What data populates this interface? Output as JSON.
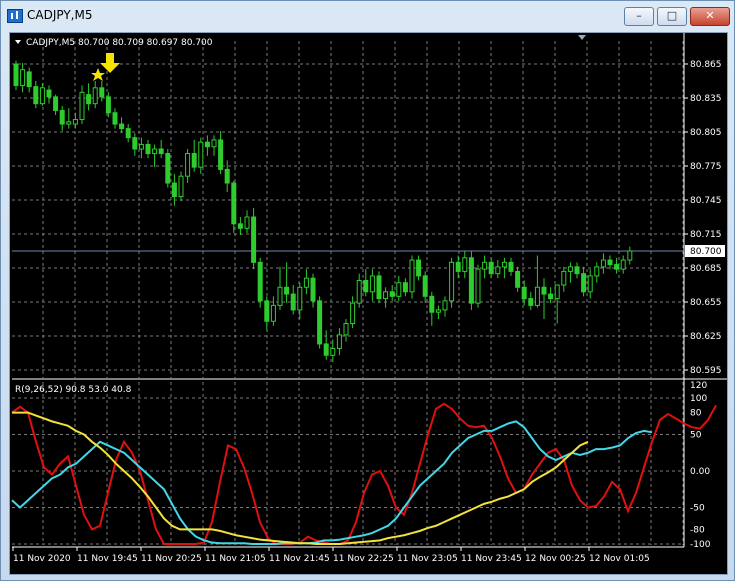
{
  "window": {
    "title": "CADJPY,M5",
    "buttons": {
      "min": "–",
      "max": "□",
      "close": "✕"
    }
  },
  "chart": {
    "header": "CADJPY,M5  80.700 80.709 80.697 80.700",
    "price_ticks": [
      "80.865",
      "80.835",
      "80.805",
      "80.775",
      "80.745",
      "80.715",
      "80.685",
      "80.655",
      "80.625",
      "80.595"
    ],
    "current_price": "80.700",
    "indicator_label": "R(9,26,52) 90.8 53.0 40.8",
    "indicator_ticks": [
      "120",
      "100",
      "80",
      "50",
      "0.00",
      "-50",
      "-80",
      "-100"
    ],
    "time_ticks": [
      "11 Nov 2020",
      "11 Nov 19:45",
      "11 Nov 20:25",
      "11 Nov 21:05",
      "11 Nov 21:45",
      "11 Nov 22:25",
      "11 Nov 23:05",
      "11 Nov 23:45",
      "12 Nov 00:25",
      "12 Nov 01:05"
    ],
    "colors": {
      "background": "#000000",
      "grid": "#7a7a7a",
      "bull": "#ffffff",
      "bear": "#2ecc2e",
      "line_red": "#e01010",
      "line_cyan": "#40d8e8",
      "line_yellow": "#f2e23a",
      "text": "#ffffff",
      "price_line": "#6f87a8",
      "arrow": "#f5e400"
    }
  },
  "chart_data": [
    {
      "type": "candlestick",
      "title": "CADJPY,M5",
      "ylim": [
        80.595,
        80.87
      ],
      "candles": [
        [
          80.865,
          80.868,
          80.842,
          80.846
        ],
        [
          80.846,
          80.866,
          80.84,
          80.86
        ],
        [
          80.858,
          80.862,
          80.84,
          80.845
        ],
        [
          80.845,
          80.85,
          80.826,
          80.83
        ],
        [
          80.83,
          80.848,
          80.828,
          80.844
        ],
        [
          80.842,
          80.846,
          80.83,
          80.836
        ],
        [
          80.836,
          80.838,
          80.82,
          80.824
        ],
        [
          80.824,
          80.828,
          80.806,
          80.812
        ],
        [
          80.812,
          80.826,
          80.808,
          80.814
        ],
        [
          80.812,
          80.822,
          80.808,
          80.816
        ],
        [
          80.816,
          80.846,
          80.812,
          80.84
        ],
        [
          80.838,
          80.848,
          80.824,
          80.83
        ],
        [
          80.83,
          80.85,
          80.826,
          80.844
        ],
        [
          80.844,
          80.85,
          80.832,
          80.836
        ],
        [
          80.836,
          80.84,
          80.818,
          80.822
        ],
        [
          80.822,
          80.826,
          80.808,
          80.812
        ],
        [
          80.812,
          80.818,
          80.804,
          80.808
        ],
        [
          80.808,
          80.812,
          80.796,
          80.8
        ],
        [
          80.8,
          80.804,
          80.784,
          80.79
        ],
        [
          80.79,
          80.8,
          80.782,
          80.794
        ],
        [
          80.794,
          80.798,
          80.782,
          80.786
        ],
        [
          80.786,
          80.794,
          80.774,
          80.79
        ],
        [
          80.79,
          80.798,
          80.782,
          80.786
        ],
        [
          80.786,
          80.79,
          80.756,
          80.76
        ],
        [
          80.76,
          80.768,
          80.74,
          80.748
        ],
        [
          80.748,
          80.77,
          80.744,
          80.766
        ],
        [
          80.766,
          80.79,
          80.76,
          80.786
        ],
        [
          80.786,
          80.798,
          80.77,
          80.774
        ],
        [
          80.774,
          80.8,
          80.768,
          80.796
        ],
        [
          80.796,
          80.802,
          80.784,
          80.792
        ],
        [
          80.792,
          80.802,
          80.784,
          80.798
        ],
        [
          80.798,
          80.806,
          80.768,
          80.772
        ],
        [
          80.772,
          80.78,
          80.752,
          80.76
        ],
        [
          80.76,
          80.762,
          80.716,
          80.724
        ],
        [
          80.724,
          80.73,
          80.714,
          80.72
        ],
        [
          80.72,
          80.736,
          80.716,
          80.73
        ],
        [
          80.73,
          80.738,
          80.684,
          80.69
        ],
        [
          80.69,
          80.694,
          80.65,
          80.656
        ],
        [
          80.656,
          80.66,
          80.63,
          80.638
        ],
        [
          80.638,
          80.66,
          80.634,
          80.652
        ],
        [
          80.652,
          80.686,
          80.648,
          80.668
        ],
        [
          80.668,
          80.69,
          80.654,
          80.662
        ],
        [
          80.662,
          80.67,
          80.644,
          80.648
        ],
        [
          80.648,
          80.672,
          80.64,
          80.668
        ],
        [
          80.668,
          80.684,
          80.662,
          80.676
        ],
        [
          80.676,
          80.68,
          80.65,
          80.656
        ],
        [
          80.656,
          80.66,
          80.614,
          80.618
        ],
        [
          80.618,
          80.63,
          80.604,
          80.608
        ],
        [
          80.608,
          80.622,
          80.602,
          80.614
        ],
        [
          80.614,
          80.632,
          80.608,
          80.626
        ],
        [
          80.626,
          80.64,
          80.62,
          80.636
        ],
        [
          80.636,
          80.66,
          80.632,
          80.654
        ],
        [
          80.654,
          80.68,
          80.65,
          80.674
        ],
        [
          80.674,
          80.684,
          80.66,
          80.664
        ],
        [
          80.664,
          80.684,
          80.656,
          80.678
        ],
        [
          80.678,
          80.682,
          80.654,
          80.658
        ],
        [
          80.658,
          80.668,
          80.65,
          80.664
        ],
        [
          80.664,
          80.67,
          80.656,
          80.66
        ],
        [
          80.66,
          80.678,
          80.656,
          80.672
        ],
        [
          80.672,
          80.676,
          80.66,
          80.664
        ],
        [
          80.664,
          80.696,
          80.658,
          80.692
        ],
        [
          80.692,
          80.696,
          80.674,
          80.678
        ],
        [
          80.678,
          80.682,
          80.654,
          80.66
        ],
        [
          80.66,
          80.664,
          80.634,
          80.646
        ],
        [
          80.646,
          80.652,
          80.64,
          80.648
        ],
        [
          80.648,
          80.66,
          80.642,
          80.656
        ],
        [
          80.656,
          80.694,
          80.65,
          80.69
        ],
        [
          80.69,
          80.696,
          80.676,
          80.682
        ],
        [
          80.682,
          80.7,
          80.676,
          80.694
        ],
        [
          80.694,
          80.7,
          80.648,
          80.654
        ],
        [
          80.654,
          80.688,
          80.65,
          80.684
        ],
        [
          80.684,
          80.696,
          80.676,
          80.69
        ],
        [
          80.69,
          80.694,
          80.676,
          80.68
        ],
        [
          80.68,
          80.692,
          80.676,
          80.686
        ],
        [
          80.686,
          80.694,
          80.676,
          80.69
        ],
        [
          80.69,
          80.694,
          80.678,
          80.682
        ],
        [
          80.682,
          80.686,
          80.664,
          80.668
        ],
        [
          80.668,
          80.674,
          80.652,
          80.658
        ],
        [
          80.658,
          80.664,
          80.648,
          80.652
        ],
        [
          80.652,
          80.696,
          80.65,
          80.668
        ],
        [
          80.668,
          80.676,
          80.64,
          80.662
        ],
        [
          80.662,
          80.668,
          80.654,
          80.658
        ],
        [
          80.658,
          80.664,
          80.636,
          80.67
        ],
        [
          80.67,
          80.686,
          80.664,
          80.682
        ],
        [
          80.682,
          80.69,
          80.672,
          80.686
        ],
        [
          80.686,
          80.69,
          80.676,
          80.68
        ],
        [
          80.68,
          80.686,
          80.66,
          80.664
        ],
        [
          80.664,
          80.684,
          80.658,
          80.678
        ],
        [
          80.678,
          80.69,
          80.672,
          80.686
        ],
        [
          80.686,
          80.698,
          80.68,
          80.692
        ],
        [
          80.692,
          80.696,
          80.684,
          80.688
        ],
        [
          80.688,
          80.694,
          80.68,
          80.684
        ],
        [
          80.684,
          80.696,
          80.68,
          80.692
        ],
        [
          80.692,
          80.704,
          80.688,
          80.7
        ]
      ]
    },
    {
      "type": "line",
      "title": "R(9,26,52) 90.8 53.0 40.8",
      "ylim": [
        -105,
        125
      ],
      "series": [
        {
          "name": "R(9)",
          "values": [
            80,
            88,
            80,
            40,
            5,
            -5,
            10,
            20,
            -20,
            -60,
            -80,
            -75,
            -30,
            15,
            40,
            25,
            0,
            -40,
            -80,
            -100,
            -100,
            -100,
            -100,
            -100,
            -98,
            -70,
            -15,
            35,
            30,
            5,
            -30,
            -70,
            -92,
            -100,
            -100,
            -100,
            -98,
            -90,
            -95,
            -98,
            -100,
            -100,
            -95,
            -70,
            -30,
            -5,
            0,
            -20,
            -50,
            -60,
            -30,
            10,
            50,
            85,
            92,
            85,
            72,
            62,
            60,
            62,
            45,
            20,
            -10,
            -30,
            -25,
            -5,
            10,
            25,
            30,
            15,
            -20,
            -40,
            -50,
            -48,
            -35,
            -15,
            -25,
            -55,
            -30,
            5,
            40,
            70,
            78,
            72,
            65,
            60,
            58,
            70,
            90
          ]
        },
        {
          "name": "R(26)",
          "values": [
            -40,
            -50,
            -40,
            -30,
            -20,
            -10,
            -5,
            5,
            10,
            20,
            30,
            40,
            35,
            30,
            25,
            15,
            5,
            -5,
            -15,
            -25,
            -45,
            -65,
            -80,
            -90,
            -95,
            -98,
            -99,
            -99,
            -99,
            -99,
            -100,
            -100,
            -100,
            -100,
            -99,
            -99,
            -99,
            -99,
            -98,
            -95,
            -95,
            -94,
            -92,
            -90,
            -88,
            -85,
            -80,
            -75,
            -65,
            -50,
            -35,
            -20,
            -10,
            0,
            10,
            25,
            35,
            45,
            50,
            55,
            55,
            60,
            65,
            68,
            60,
            45,
            30,
            20,
            15,
            20,
            25,
            22,
            25,
            30,
            30,
            32,
            35,
            45,
            52,
            55,
            53
          ]
        },
        {
          "name": "R(52)",
          "values": [
            80,
            80,
            80,
            76,
            72,
            68,
            65,
            62,
            55,
            50,
            40,
            32,
            22,
            10,
            0,
            -10,
            -22,
            -35,
            -50,
            -65,
            -75,
            -80,
            -80,
            -80,
            -80,
            -80,
            -82,
            -85,
            -88,
            -90,
            -92,
            -94,
            -95,
            -96,
            -97,
            -98,
            -99,
            -99,
            -100,
            -100,
            -100,
            -100,
            -99,
            -98,
            -97,
            -96,
            -95,
            -92,
            -90,
            -88,
            -85,
            -82,
            -78,
            -75,
            -70,
            -65,
            -60,
            -55,
            -50,
            -45,
            -42,
            -38,
            -35,
            -30,
            -25,
            -15,
            -8,
            -2,
            5,
            15,
            25,
            35,
            40
          ]
        }
      ]
    }
  ]
}
